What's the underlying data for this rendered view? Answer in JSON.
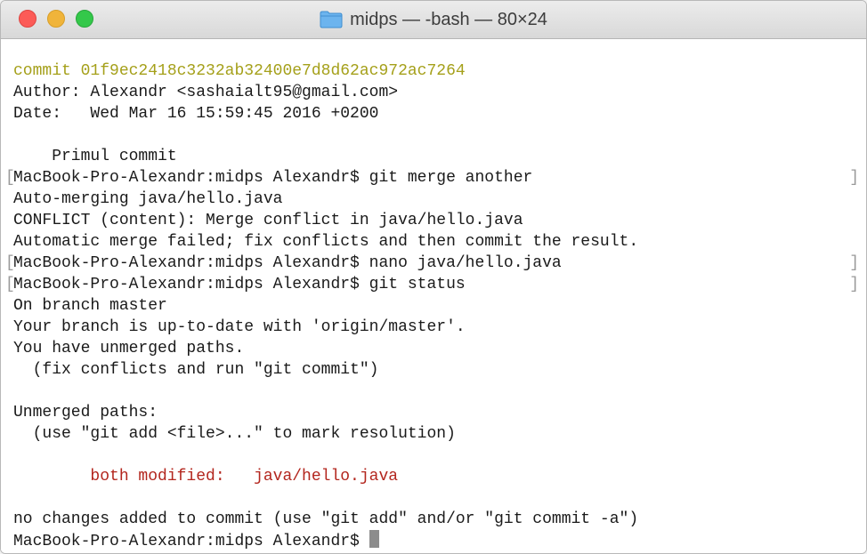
{
  "window": {
    "title": "midps — -bash — 80×24"
  },
  "terminal": {
    "lines": [
      "commit 01f9ec2418c3232ab32400e7d8d62ac972ac7264",
      "Author: Alexandr <sashaialt95@gmail.com>",
      "Date:   Wed Mar 16 15:59:45 2016 +0200",
      "",
      "    Primul commit",
      "MacBook-Pro-Alexandr:midps Alexandr$ git merge another",
      "Auto-merging java/hello.java",
      "CONFLICT (content): Merge conflict in java/hello.java",
      "Automatic merge failed; fix conflicts and then commit the result.",
      "MacBook-Pro-Alexandr:midps Alexandr$ nano java/hello.java",
      "MacBook-Pro-Alexandr:midps Alexandr$ git status",
      "On branch master",
      "Your branch is up-to-date with 'origin/master'.",
      "You have unmerged paths.",
      "  (fix conflicts and run \"git commit\")",
      "",
      "Unmerged paths:",
      "  (use \"git add <file>...\" to mark resolution)",
      "",
      "        both modified:   java/hello.java",
      "",
      "no changes added to commit (use \"git add\" and/or \"git commit -a\")",
      "MacBook-Pro-Alexandr:midps Alexandr$ "
    ],
    "marks": {
      "left": "[",
      "right": "]"
    }
  },
  "colors": {
    "commit_hash": "#a5a01a",
    "conflict_red": "#b3261e",
    "text": "#1a1a1a"
  },
  "icons": {
    "folder": "folder-icon",
    "cursor": "block-cursor"
  }
}
